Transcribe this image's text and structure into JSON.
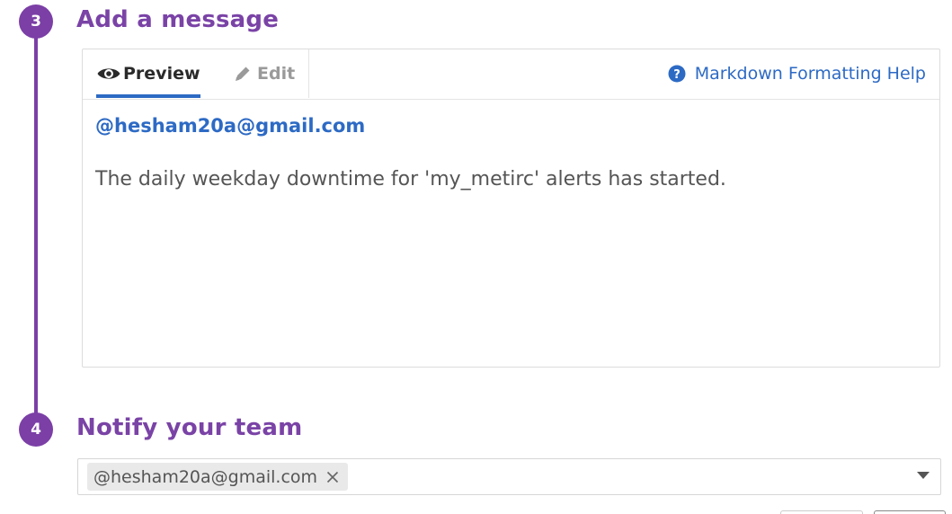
{
  "steps": {
    "message": {
      "number": "3",
      "title": "Add a message"
    },
    "notify": {
      "number": "4",
      "title": "Notify your team"
    }
  },
  "editor": {
    "tabs": {
      "preview_label": "Preview",
      "edit_label": "Edit",
      "active": "preview"
    },
    "help_link_label": "Markdown Formatting Help",
    "preview": {
      "mention": "@hesham20a@gmail.com",
      "text": "The daily weekday downtime for 'my_metirc' alerts has started."
    }
  },
  "notify": {
    "recipients": [
      "@hesham20a@gmail.com"
    ]
  },
  "icons": {
    "preview": "eye-icon",
    "edit": "pencil-icon",
    "help": "question-circle-icon",
    "remove_chip": "close-icon",
    "dropdown": "caret-down-icon"
  },
  "colors": {
    "step_accent": "#7b3fa6",
    "link": "#2d6ac4",
    "text": "#555555"
  }
}
